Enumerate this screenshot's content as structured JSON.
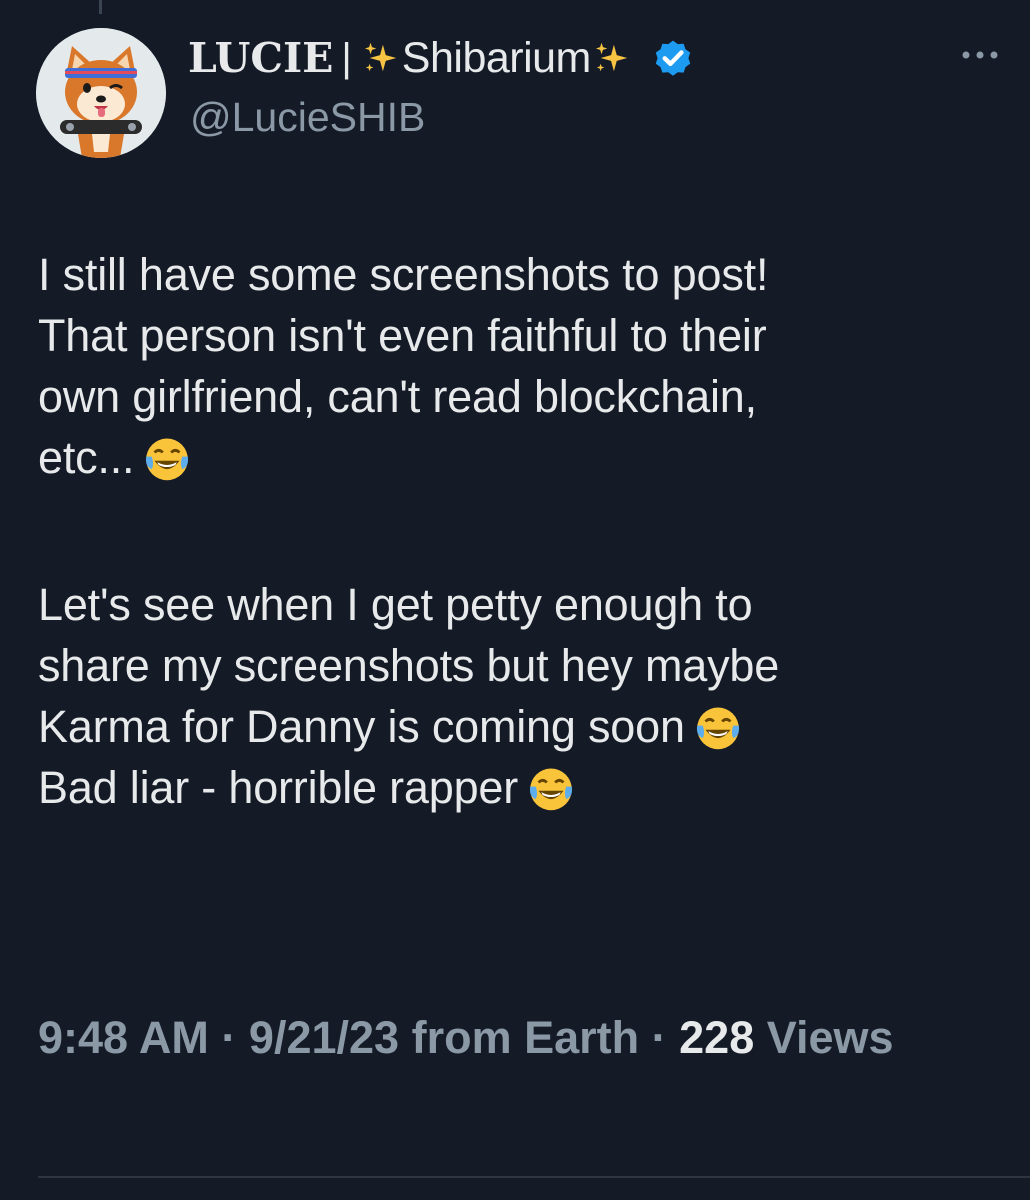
{
  "tweet": {
    "author": {
      "name": "LUCIE",
      "separator": "|",
      "brand": "Shibarium",
      "handle": "@LucieSHIB",
      "verified": true
    },
    "more_icon": "more-horizontal-icon",
    "text_lines": [
      "I still have some screenshots to post!",
      "That person isn't even faithful to their",
      "own girlfriend, can't read blockchain,",
      "etc...",
      "Let's see when I get petty enough to",
      "share my screenshots but hey maybe",
      "Karma for Danny is coming soon",
      "Bad liar - horrible rapper"
    ],
    "emoji": "face-with-tears-of-joy",
    "meta": {
      "time": "9:48 AM",
      "dot": "·",
      "date": "9/21/23",
      "location": "from Earth",
      "views_count": "228",
      "views_label": "Views"
    },
    "colors": {
      "background": "#141b27",
      "text": "#e7e9ea",
      "secondary": "#8b98a5",
      "verified": "#1d9bf0"
    }
  }
}
